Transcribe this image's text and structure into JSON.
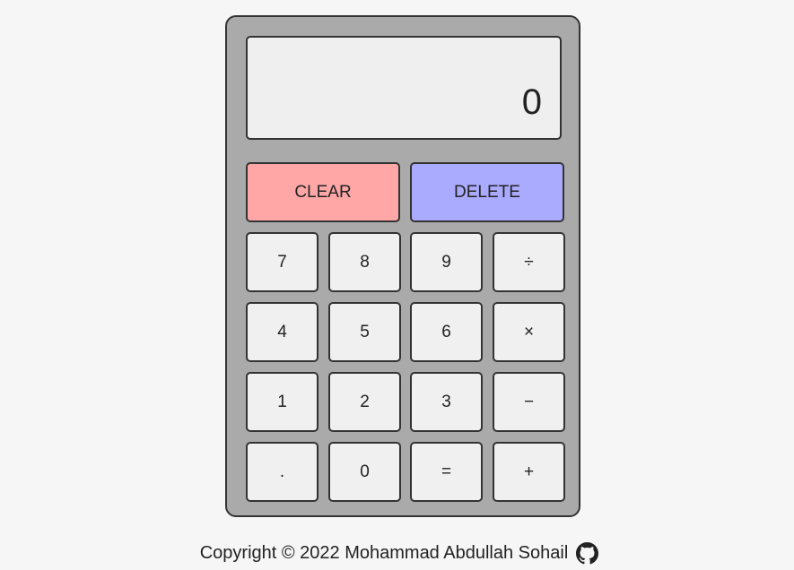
{
  "display": {
    "value": "0"
  },
  "actions": {
    "clear_label": "CLEAR",
    "delete_label": "DELETE"
  },
  "keys": {
    "row1": [
      "7",
      "8",
      "9",
      "÷"
    ],
    "row2": [
      "4",
      "5",
      "6",
      "×"
    ],
    "row3": [
      "1",
      "2",
      "3",
      "−"
    ],
    "row4": [
      ".",
      "0",
      "=",
      "+"
    ]
  },
  "footer": {
    "text": "Copyright © 2022 Mohammad Abdullah Sohail",
    "icon": "github-icon"
  },
  "colors": {
    "background": "#f6f6f6",
    "calculator_body": "#aaaaaa",
    "screen": "#efefef",
    "clear_button": "#ffa6a6",
    "delete_button": "#aaaaff",
    "key": "#f0f0f0",
    "border": "#333333"
  }
}
